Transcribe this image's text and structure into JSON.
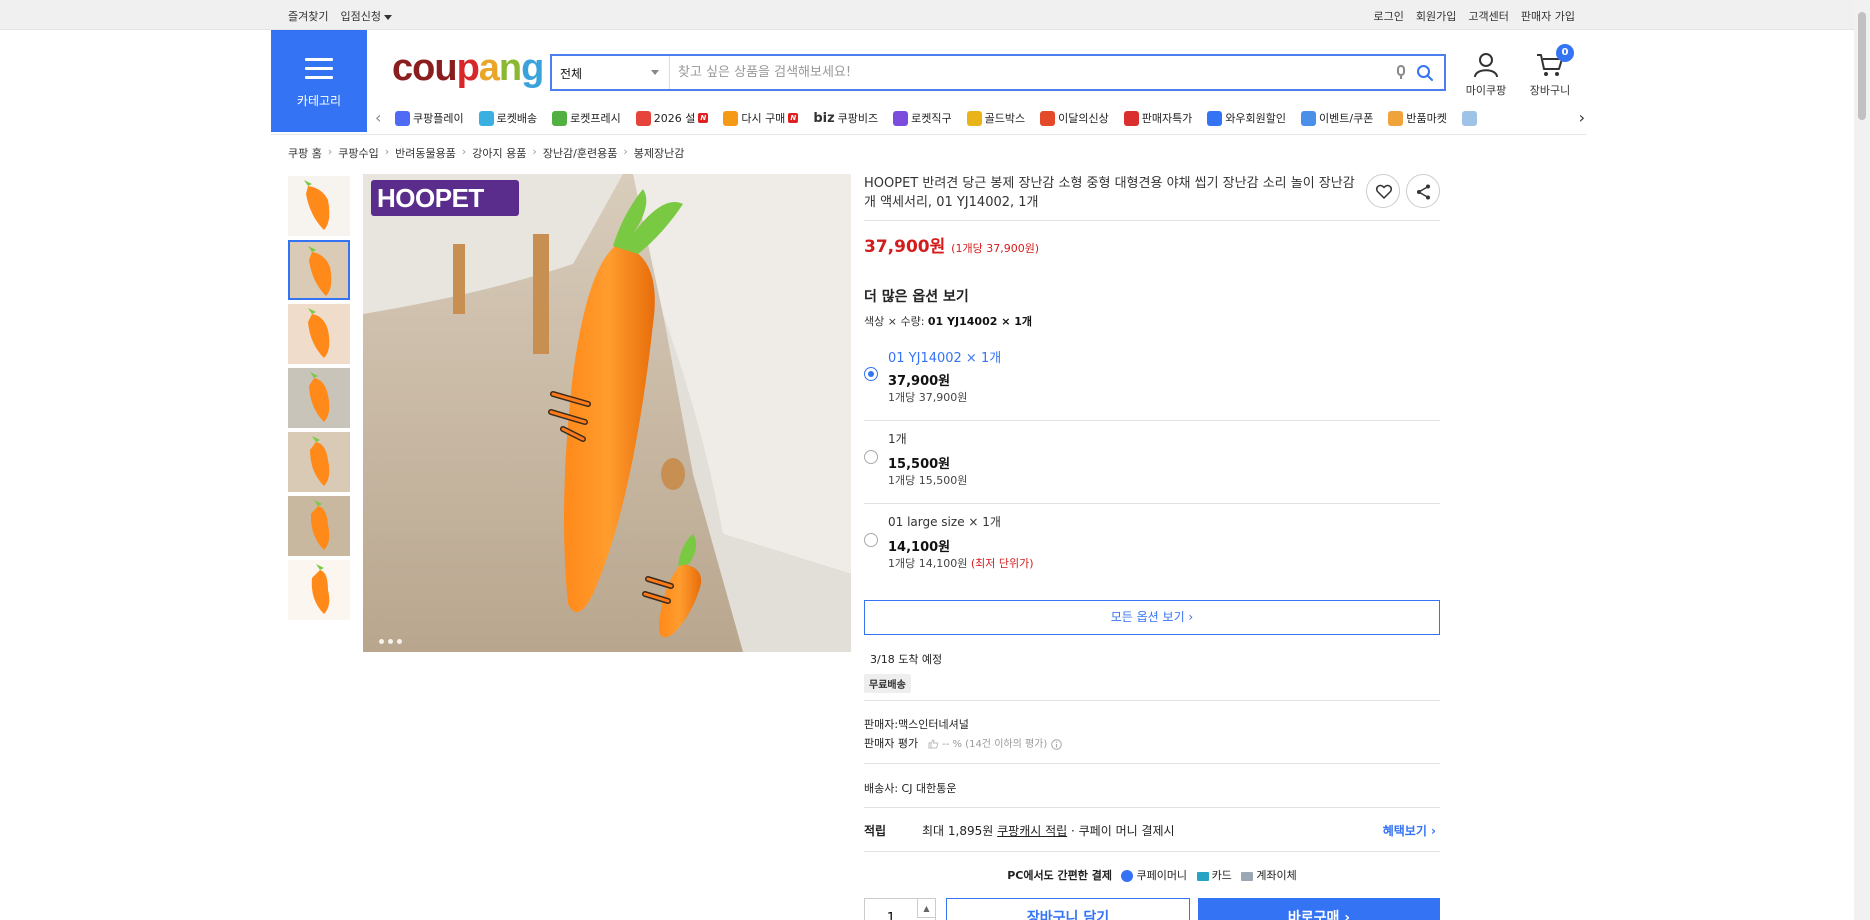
{
  "topbar": {
    "left": [
      "즐겨찾기",
      "입점신청"
    ],
    "right": [
      "로그인",
      "회원가입",
      "고객센터",
      "판매자 가입"
    ]
  },
  "header": {
    "category_label": "카테고리",
    "logo_parts": [
      "cou",
      "p",
      "a",
      "n",
      "g"
    ],
    "search_category": "전체",
    "search_placeholder": "찾고 싶은 상품을 검색해보세요!",
    "mypage_label": "마이쿠팡",
    "cart_label": "장바구니",
    "cart_count": "0"
  },
  "nav": {
    "items": [
      {
        "label": "쿠팡플레이",
        "icon": "play-icon",
        "color": "#4f6bf5"
      },
      {
        "label": "로켓배송",
        "icon": "rocket-icon",
        "color": "#3ab0e2"
      },
      {
        "label": "로켓프레시",
        "icon": "rocket-fresh-icon",
        "color": "#52b043"
      },
      {
        "label": "2026 설",
        "icon": "gift-icon",
        "color": "#e6443b",
        "new": "N"
      },
      {
        "label": "다시 구매",
        "icon": "home-icon",
        "color": "#f59a16",
        "new": "N"
      },
      {
        "label": "쿠팡비즈",
        "icon": "biz-logo",
        "prefix": "biz",
        "color": "#333333"
      },
      {
        "label": "로켓직구",
        "icon": "global-rocket-icon",
        "color": "#7c4ddc"
      },
      {
        "label": "골드박스",
        "icon": "goldbox-icon",
        "color": "#e8b417"
      },
      {
        "label": "이달의신상",
        "icon": "new-products-icon",
        "color": "#e24a2a"
      },
      {
        "label": "판매자특가",
        "icon": "seller-deal-icon",
        "color": "#d9302f"
      },
      {
        "label": "와우회원할인",
        "icon": "wow-icon",
        "color": "#3573f5"
      },
      {
        "label": "이벤트/쿠폰",
        "icon": "coupon-icon",
        "color": "#4a8fe8"
      },
      {
        "label": "반품마켓",
        "icon": "return-market-icon",
        "color": "#f0a33a"
      },
      {
        "label": "",
        "icon": "more-icon",
        "color": "#9ec3e6"
      }
    ]
  },
  "breadcrumb": [
    "쿠팡 홈",
    "쿠팡수입",
    "반려동물용품",
    "강아지 용품",
    "장난감/훈련용품",
    "봉제장난감"
  ],
  "gallery": {
    "brand": "HOOPET",
    "dots": 3,
    "thumbs": 7,
    "active_thumb": 1
  },
  "product": {
    "title": "HOOPET 반려견 당근 봉제 장난감 소형 중형 대형견용 야채 씹기 장난감 소리 놀이 장난감 개 액세서리, 01 YJ14002, 1개",
    "price": "37,900원",
    "unit_price": "(1개당 37,900원)",
    "options_heading": "더 많은 옵션 보기",
    "selected_label": "색상 × 수량:",
    "selected_value": "01 YJ14002 × 1개",
    "options": [
      {
        "name": "01 YJ14002 × 1개",
        "price": "37,900원",
        "unit": "1개당 37,900원",
        "note": "",
        "selected": true
      },
      {
        "name": "1개",
        "price": "15,500원",
        "unit": "1개당 15,500원",
        "note": "",
        "selected": false
      },
      {
        "name": "01 large size × 1개",
        "price": "14,100원",
        "unit": "1개당 14,100원",
        "note": "(최저 단위가)",
        "selected": false
      }
    ],
    "all_options_label": "모든 옵션 보기 ›",
    "arrival": "3/18 도착 예정",
    "free_shipping": "무료배송",
    "seller": "판매자:맥스인터네셔널",
    "seller_rating_label": "판매자 평가",
    "seller_rating_value": "-- % (14건 이하의 평가)",
    "courier": "배송사:  CJ 대한통운",
    "reward_label": "적립",
    "reward_max": "최대 1,895원",
    "reward_link": "쿠팡캐시 적립",
    "reward_suffix": "· 쿠페이 머니 결제시",
    "reward_more": "혜택보기 ›",
    "pay_heading": "PC에서도 간편한 결제",
    "pay_methods": [
      "쿠페이머니",
      "카드",
      "계좌이체"
    ],
    "quantity": "1",
    "cart_button": "장바구니 담기",
    "buy_button": "바로구매 ›"
  }
}
